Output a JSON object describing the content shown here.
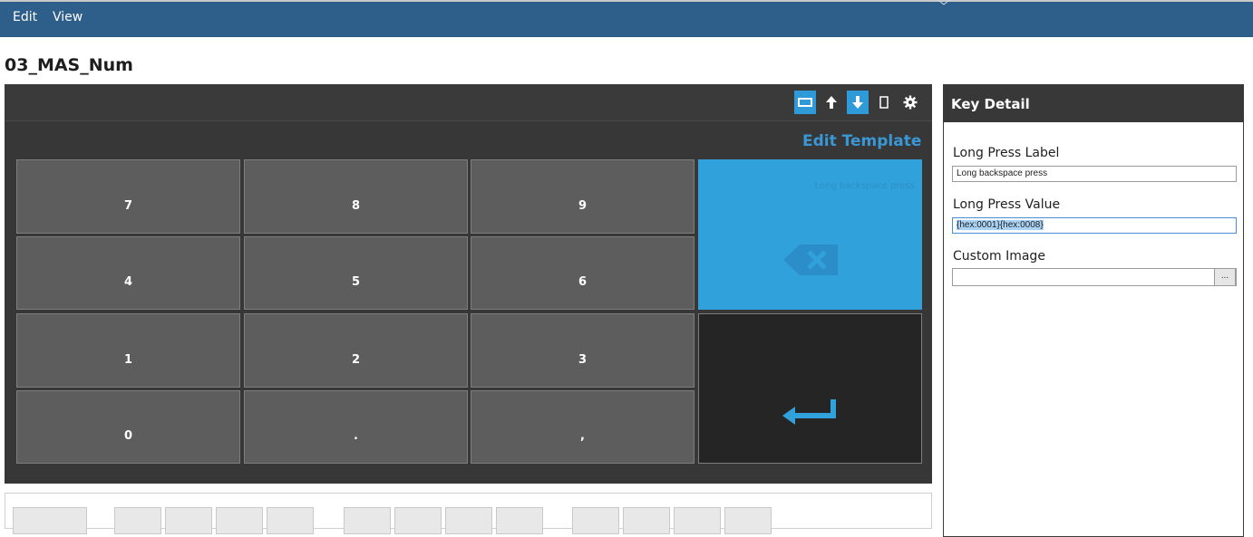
{
  "menu": {
    "items": [
      "Edit",
      "View"
    ]
  },
  "page": {
    "title": "03_MAS_Num"
  },
  "toolbar": {
    "buttons": [
      {
        "icon": "layout-landscape-icon",
        "active": true
      },
      {
        "icon": "arrow-up-icon",
        "active": false
      },
      {
        "icon": "arrow-down-icon",
        "active": true
      },
      {
        "icon": "layout-portrait-icon",
        "active": false
      },
      {
        "icon": "gear-icon",
        "active": false
      }
    ]
  },
  "keyboard": {
    "edit_template_label": "Edit Template",
    "keys": [
      "7",
      "8",
      "9",
      "4",
      "5",
      "6",
      "1",
      "2",
      "3",
      "0",
      ".",
      ","
    ],
    "backspace_hint": "Long backspace press",
    "backspace_icon": "backspace-icon",
    "enter_icon": "enter-icon",
    "accent_color": "#31a1db"
  },
  "detail": {
    "title": "Key Detail",
    "long_press_label_caption": "Long Press Label",
    "long_press_label_value": "Long backspace press",
    "long_press_value_caption": "Long Press Value",
    "long_press_value": "{hex:0001}{hex:0008}",
    "custom_image_caption": "Custom Image",
    "custom_image_value": "",
    "browse_label": "..."
  }
}
